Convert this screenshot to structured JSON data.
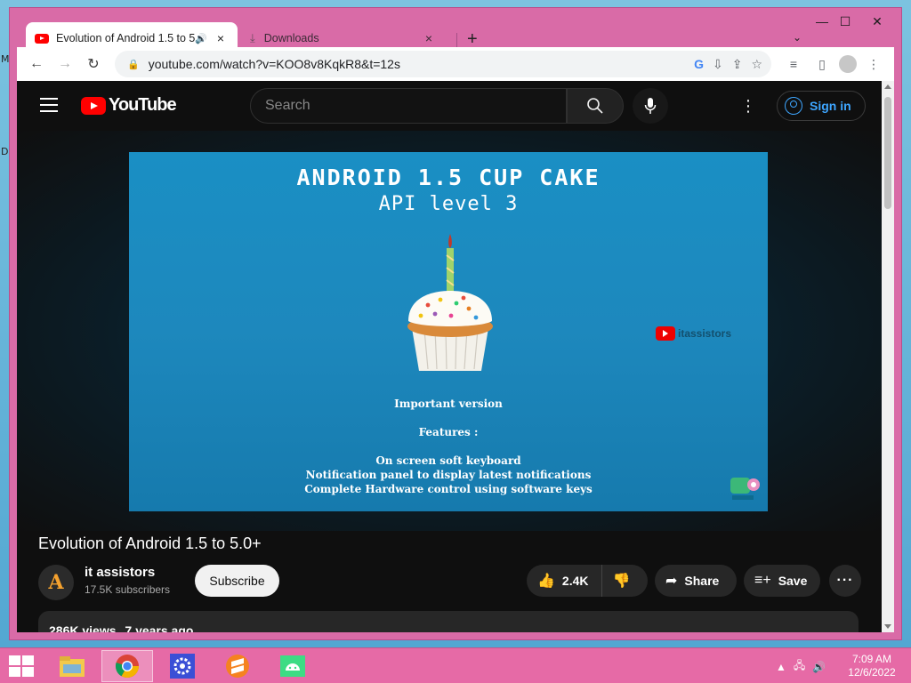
{
  "desktop": {
    "marks": [
      "M",
      "D"
    ]
  },
  "window": {
    "controls": {
      "minimize": "—",
      "maximize": "☐",
      "close": "✕"
    }
  },
  "tabs": [
    {
      "title": "Evolution of Android 1.5 to 5",
      "audio_icon": "🔊",
      "close": "×",
      "active": true
    },
    {
      "title": "Downloads",
      "close": "×",
      "active": false
    }
  ],
  "new_tab": "+",
  "address_bar": {
    "url": "youtube.com/watch?v=KOO8v8KqkR8&t=12s"
  },
  "youtube": {
    "logo_text": "YouTube",
    "search_placeholder": "Search",
    "sign_in": "Sign in",
    "video": {
      "slide_title": "ANDROID 1.5 CUP CAKE",
      "slide_subtitle": "API level 3",
      "important": "Important version",
      "features_heading": "Features :",
      "features": [
        "On screen soft keyboard",
        "Notification panel to display latest notifications",
        "Complete Hardware control using software keys"
      ],
      "watermark": "itassistors"
    },
    "title": "Evolution of Android 1.5 to 5.0+",
    "channel": {
      "name": "it assistors",
      "subscribers": "17.5K subscribers",
      "avatar_letter": "A"
    },
    "subscribe": "Subscribe",
    "likes": "2.4K",
    "share": "Share",
    "save": "Save",
    "more": "···",
    "description": {
      "views": "286K views",
      "age": "7 years ago"
    }
  },
  "taskbar": {
    "apps": [
      "file-explorer",
      "chrome",
      "settings",
      "sublime",
      "android-studio"
    ],
    "clock": {
      "time": "7:09 AM",
      "date": "12/6/2022"
    }
  },
  "colors": {
    "window_frame": "#d96ba7",
    "youtube_bg": "#0f0f0f",
    "youtube_red": "#ff0000",
    "signin_blue": "#3ea6ff",
    "video_blue": "#1a8fc4",
    "taskbar": "#e66aa6"
  }
}
